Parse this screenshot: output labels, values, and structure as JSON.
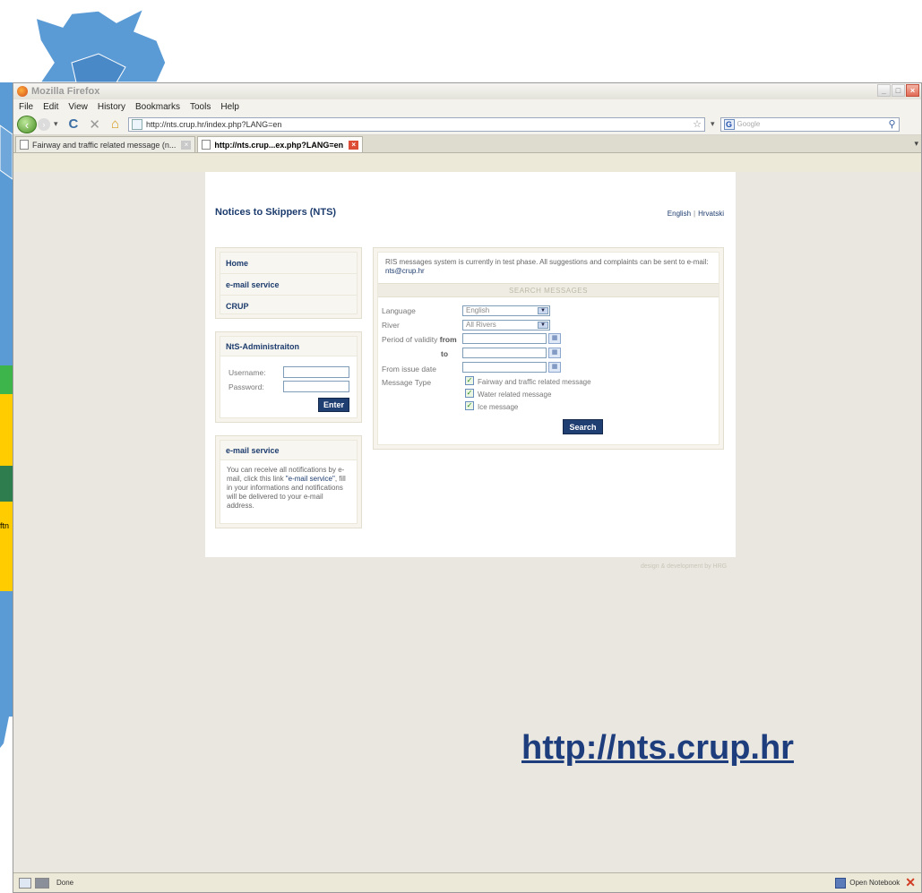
{
  "map": {
    "fragment_label": "ftn"
  },
  "browser": {
    "window_title": "Mozilla Firefox",
    "menus": [
      "File",
      "Edit",
      "View",
      "History",
      "Bookmarks",
      "Tools",
      "Help"
    ],
    "url": "http://nts.crup.hr/index.php?LANG=en",
    "search_placeholder": "Google",
    "tabs": [
      "Fairway and traffic related message (n...",
      "http://nts.crup...ex.php?LANG=en"
    ],
    "status": "Done",
    "notebook_label": "Open Notebook"
  },
  "page": {
    "title": "Notices to Skippers (NTS)",
    "languages": [
      "English",
      "Hrvatski"
    ],
    "menu": [
      "Home",
      "e-mail service",
      "CRUP"
    ],
    "admin": {
      "heading": "NtS-Administraiton",
      "username_label": "Username:",
      "password_label": "Password:",
      "enter_label": "Enter"
    },
    "email_box": {
      "heading": "e-mail service",
      "text_before": "You can receive all notifications by e-mail, click this link ",
      "link_text": "\"e-mail service\"",
      "text_after": ", fill in your informations and notifications will be delivered to your e-mail address."
    },
    "search": {
      "notice": "RIS messages system is currently in test phase. All suggestions and complaints can be sent to e-mail: ",
      "notice_email": "nts@crup.hr",
      "heading": "SEARCH MESSAGES",
      "language_label": "Language",
      "language_value": "English",
      "river_label": "River",
      "river_value": "All Rivers",
      "validity_label": "Period of validity",
      "from_label": "from",
      "to_label": "to",
      "issue_date_label": "From issue date",
      "message_type_label": "Message Type",
      "message_types": [
        "Fairway and traffic related message",
        "Water related message",
        "Ice message"
      ],
      "search_label": "Search"
    },
    "footer": "design & development by HRG"
  },
  "slide": {
    "url_caption": "http://nts.crup.hr"
  }
}
